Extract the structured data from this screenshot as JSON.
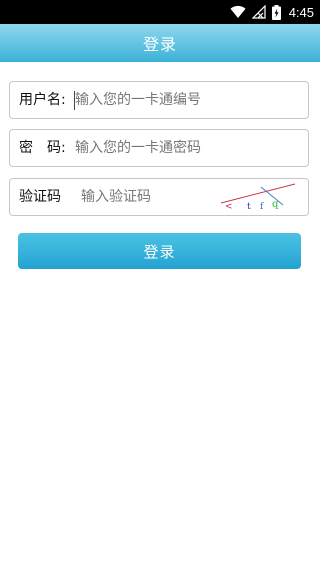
{
  "status_bar": {
    "time": "4:45",
    "icons": [
      "wifi-icon",
      "signal-off-icon",
      "battery-icon"
    ]
  },
  "header": {
    "title": "登录"
  },
  "form": {
    "username": {
      "label": "用户名:",
      "value": "",
      "placeholder": "输入您的一卡通编号"
    },
    "password": {
      "label": "密　码:",
      "value": "",
      "placeholder": "输入您的一卡通密码"
    },
    "captcha": {
      "label": "验证码",
      "value": "",
      "placeholder": "输入验证码",
      "image_text": "< t f q"
    }
  },
  "login_button": {
    "label": "登录"
  },
  "colors": {
    "header_gradient_top": "#8fd8ee",
    "header_gradient_bottom": "#3cb1d8",
    "button_top": "#4cc2e4",
    "button_bottom": "#23a3d2"
  }
}
